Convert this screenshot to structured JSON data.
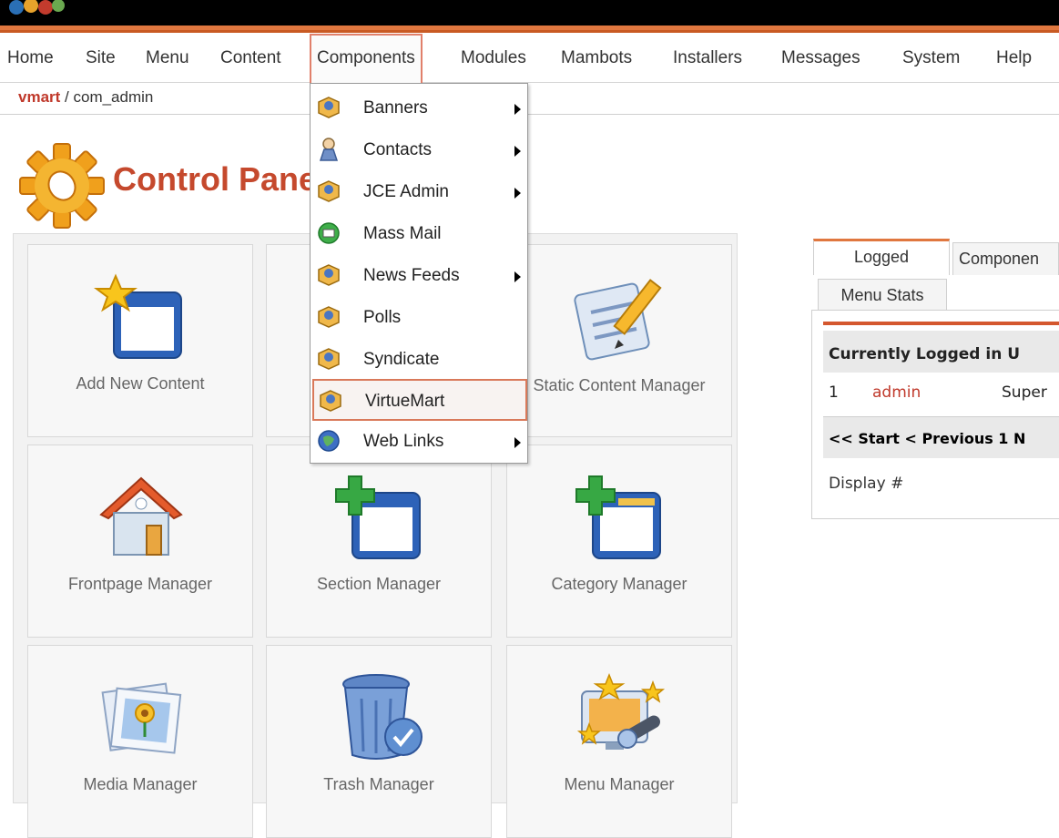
{
  "menubar": {
    "items": [
      {
        "label": "Home",
        "name": "menu-home"
      },
      {
        "label": "Site",
        "name": "menu-site"
      },
      {
        "label": "Menu",
        "name": "menu-menu"
      },
      {
        "label": "Content",
        "name": "menu-content"
      },
      {
        "label": "Components",
        "name": "menu-components",
        "active": true
      },
      {
        "label": "Modules",
        "name": "menu-modules"
      },
      {
        "label": "Mambots",
        "name": "menu-mambots"
      },
      {
        "label": "Installers",
        "name": "menu-installers"
      },
      {
        "label": "Messages",
        "name": "menu-messages"
      },
      {
        "label": "System",
        "name": "menu-system"
      },
      {
        "label": "Help",
        "name": "menu-help"
      }
    ]
  },
  "breadcrumb": {
    "link": "vmart",
    "separator": " / ",
    "current": "com_admin"
  },
  "page": {
    "title": "Control Panel"
  },
  "components_menu": {
    "items": [
      {
        "label": "Banners",
        "icon": "package-icon",
        "submenu": true
      },
      {
        "label": "Contacts",
        "icon": "contact-person-icon",
        "submenu": true
      },
      {
        "label": "JCE Admin",
        "icon": "package-icon",
        "submenu": true
      },
      {
        "label": "Mass Mail",
        "icon": "mail-globe-icon",
        "submenu": false
      },
      {
        "label": "News Feeds",
        "icon": "package-icon",
        "submenu": true
      },
      {
        "label": "Polls",
        "icon": "package-icon",
        "submenu": false
      },
      {
        "label": "Syndicate",
        "icon": "package-icon",
        "submenu": false
      },
      {
        "label": "VirtueMart",
        "icon": "package-icon",
        "submenu": false,
        "highlighted": true
      },
      {
        "label": "Web Links",
        "icon": "globe-icon",
        "submenu": true
      }
    ]
  },
  "tiles": [
    {
      "label": "Add New Content",
      "icon": "add-content-icon"
    },
    {
      "label": "",
      "icon": ""
    },
    {
      "label": "Static Content Manager",
      "icon": "static-content-icon"
    },
    {
      "label": "Frontpage Manager",
      "icon": "house-icon"
    },
    {
      "label": "Section Manager",
      "icon": "section-icon"
    },
    {
      "label": "Category Manager",
      "icon": "category-icon"
    },
    {
      "label": "Media Manager",
      "icon": "media-icon"
    },
    {
      "label": "Trash Manager",
      "icon": "trash-icon"
    },
    {
      "label": "Menu Manager",
      "icon": "menu-manager-icon"
    }
  ],
  "stats_panel": {
    "tabs": {
      "logged": "Logged",
      "components": "Componen",
      "menu_stats": "Menu Stats"
    },
    "header": "Currently Logged in U",
    "row": {
      "index": "1",
      "user": "admin",
      "role": "Super"
    },
    "nav": "<< Start < Previous 1 N",
    "display": "Display #"
  },
  "colors": {
    "accent": "#e0773f",
    "title": "#c5492d",
    "link": "#c0392b"
  }
}
